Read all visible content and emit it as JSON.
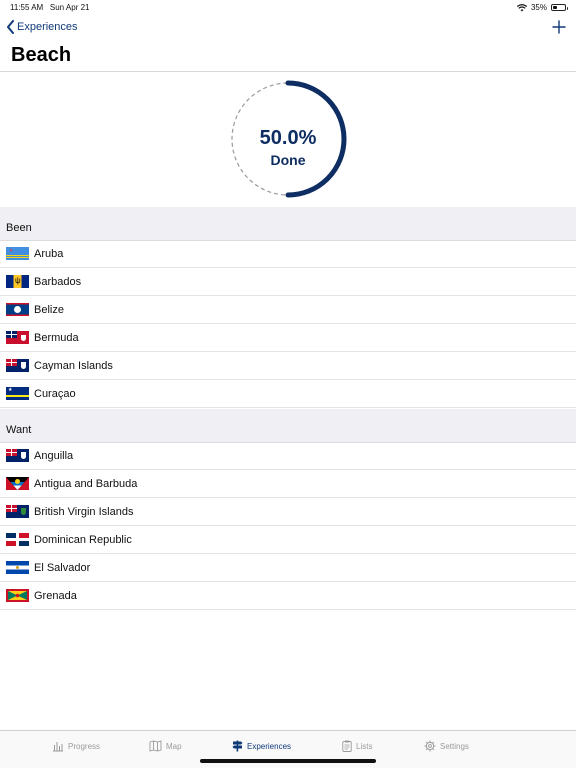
{
  "status": {
    "time": "11:55 AM",
    "date": "Sun Apr 21",
    "battery": "35%",
    "battery_level": 0.35
  },
  "nav": {
    "back_label": "Experiences",
    "title": "Beach"
  },
  "progress": {
    "percent_label": "50.0%",
    "done_label": "Done",
    "fraction": 0.5
  },
  "colors": {
    "accent": "#0f3a78",
    "ring": "#0d2d63",
    "section_bg": "#efeff4"
  },
  "sections": [
    {
      "header": "Been",
      "items": [
        {
          "name": "Aruba",
          "flag": "aruba-flag-icon"
        },
        {
          "name": "Barbados",
          "flag": "barbados-flag-icon"
        },
        {
          "name": "Belize",
          "flag": "belize-flag-icon"
        },
        {
          "name": "Bermuda",
          "flag": "bermuda-flag-icon"
        },
        {
          "name": "Cayman Islands",
          "flag": "cayman-islands-flag-icon"
        },
        {
          "name": "Curaçao",
          "flag": "curacao-flag-icon"
        }
      ]
    },
    {
      "header": "Want",
      "items": [
        {
          "name": "Anguilla",
          "flag": "anguilla-flag-icon"
        },
        {
          "name": "Antigua and Barbuda",
          "flag": "antigua-flag-icon"
        },
        {
          "name": "British Virgin Islands",
          "flag": "bvi-flag-icon"
        },
        {
          "name": "Dominican Republic",
          "flag": "dominican-republic-flag-icon"
        },
        {
          "name": "El Salvador",
          "flag": "el-salvador-flag-icon"
        },
        {
          "name": "Grenada",
          "flag": "grenada-flag-icon"
        }
      ]
    }
  ],
  "tabs": [
    {
      "label": "Progress",
      "icon": "bar-chart-icon",
      "active": false
    },
    {
      "label": "Map",
      "icon": "map-icon",
      "active": false
    },
    {
      "label": "Experiences",
      "icon": "signpost-icon",
      "active": true
    },
    {
      "label": "Lists",
      "icon": "clipboard-icon",
      "active": false
    },
    {
      "label": "Settings",
      "icon": "gear-icon",
      "active": false
    }
  ]
}
